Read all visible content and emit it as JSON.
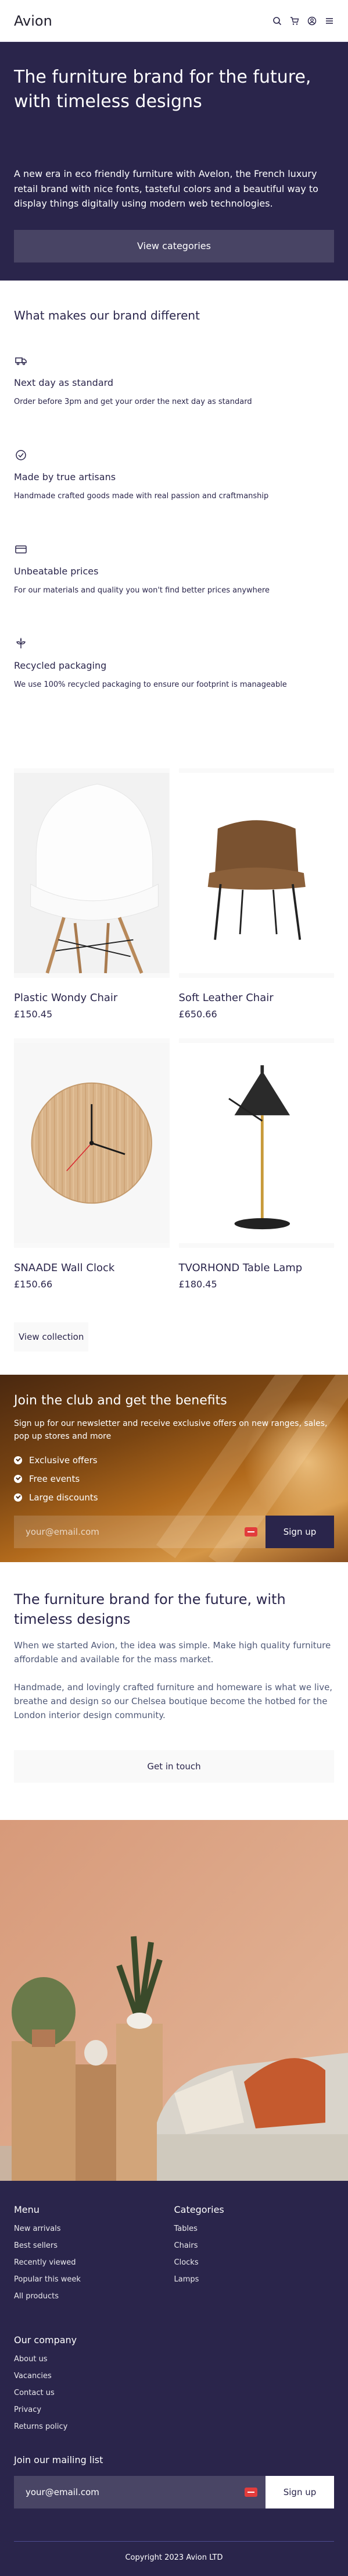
{
  "header": {
    "logo": "Avion",
    "icons": [
      "search-icon",
      "cart-icon",
      "user-icon",
      "menu-icon"
    ]
  },
  "hero": {
    "title": "The furniture brand for the future, with timeless designs",
    "description": "A new era in eco friendly furniture with Avelon, the French luxury retail brand with nice fonts, tasteful colors and a beautiful way to display things digitally using modern web technologies.",
    "button_label": "View categories"
  },
  "features": {
    "title": "What makes our brand different",
    "items": [
      {
        "icon": "delivery-icon",
        "title": "Next day as standard",
        "description": "Order before 3pm and get your order the next day as standard"
      },
      {
        "icon": "checkmark-icon",
        "title": "Made by true artisans",
        "description": "Handmade crafted goods made with real passion and craftmanship"
      },
      {
        "icon": "credit-card-icon",
        "title": "Unbeatable prices",
        "description": "For our materials and quality you won't find better prices anywhere"
      },
      {
        "icon": "plant-icon",
        "title": "Recycled packaging",
        "description": "We use 100% recycled packaging to ensure our footprint is manageable"
      }
    ]
  },
  "products": [
    {
      "name": "Plastic Wondy Chair",
      "price": "£150.45"
    },
    {
      "name": "Soft Leather Chair",
      "price": "£650.66"
    },
    {
      "name": "SNAADE Wall Clock",
      "price": "£150.66"
    },
    {
      "name": "TVORHOND Table Lamp",
      "price": "£180.45"
    }
  ],
  "collection_button": "View collection",
  "club": {
    "title": "Join the club and get the benefits",
    "description": "Sign up for our newsletter and receive exclusive offers on new ranges, sales, pop up stores and more",
    "benefits": [
      "Exclusive offers",
      "Free events",
      "Large discounts"
    ],
    "email_placeholder": "your@email.com",
    "button_label": "Sign up"
  },
  "about": {
    "title": "The furniture brand for the future, with timeless designs",
    "paragraph1": "When we started Avion, the idea was simple. Make high quality furniture affordable and available for the mass market.",
    "paragraph2": "Handmade, and lovingly crafted furniture and homeware is what we live, breathe and design so our Chelsea boutique become the hotbed for the London interior design community.",
    "button_label": "Get in touch"
  },
  "footer": {
    "menu_title": "Menu",
    "menu_items": [
      "New arrivals",
      "Best sellers",
      "Recently viewed",
      "Popular this week",
      "All products"
    ],
    "categories_title": "Categories",
    "categories_items": [
      "Tables",
      "Chairs",
      "Clocks",
      "Lamps"
    ],
    "company_title": "Our company",
    "company_items": [
      "About us",
      "Vacancies",
      "Contact us",
      "Privacy",
      "Returns policy"
    ],
    "mailing_title": "Join our mailing list",
    "email_placeholder": "your@email.com",
    "button_label": "Sign up",
    "copyright": "Copyright 2023 Avion LTD"
  },
  "colors": {
    "primary": "#2A254B",
    "light_bg": "#F9F9F9",
    "alert_red": "#E23C3C"
  }
}
